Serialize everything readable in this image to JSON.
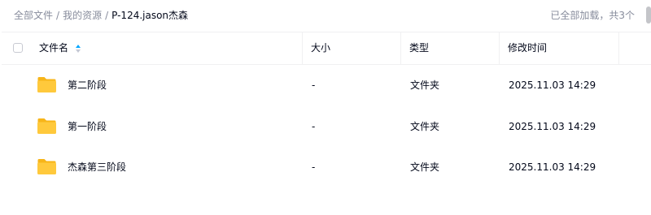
{
  "breadcrumb": {
    "root": "全部文件",
    "sep1": "/",
    "middle": "我的资源",
    "sep2": "/",
    "current": "P-124.jason杰森"
  },
  "status": {
    "text": "已全部加载，共3个"
  },
  "table": {
    "headers": {
      "name": "文件名",
      "size": "大小",
      "type": "类型",
      "modified": "修改时间"
    },
    "rows": [
      {
        "name": "第二阶段",
        "size": "-",
        "type": "文件夹",
        "modified": "2025.11.03 14:29",
        "icon": "folder-icon"
      },
      {
        "name": "第一阶段",
        "size": "-",
        "type": "文件夹",
        "modified": "2025.11.03 14:29",
        "icon": "folder-icon"
      },
      {
        "name": "杰森第三阶段",
        "size": "-",
        "type": "文件夹",
        "modified": "2025.11.03 14:29",
        "icon": "folder-icon"
      }
    ]
  },
  "colors": {
    "accent": "#06a7ff",
    "text": "#03081a",
    "muted": "#878c9c",
    "folder": "#ffc93c"
  }
}
